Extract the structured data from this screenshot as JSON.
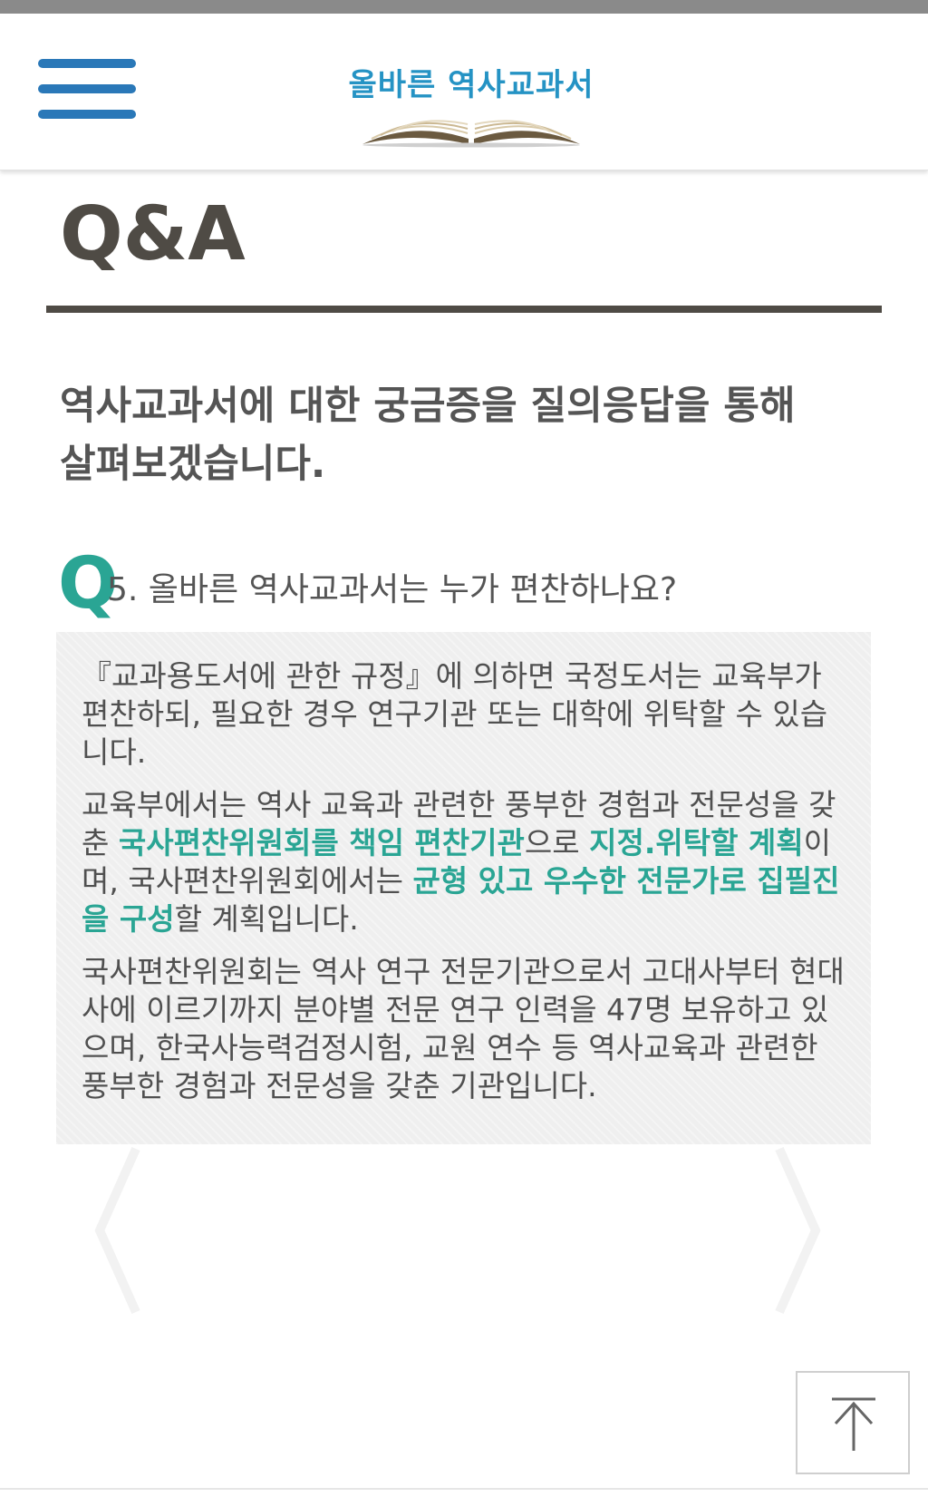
{
  "header": {
    "logo_text": "올바른 역사교과서",
    "icons": {
      "menu": "hamburger-menu-icon",
      "logo_image": "open-book-icon"
    },
    "accent_color": "#2a78b8"
  },
  "page": {
    "title": "Q&A",
    "intro_line1": "역사교과서에 대한 궁금증을 질의응답을 통해",
    "intro_line2": "살펴보겠습니다."
  },
  "question": {
    "mark": "Q",
    "text": "5. 올바른 역사교과서는 누가 편찬하나요?",
    "accent_color": "#2aa594"
  },
  "answer": {
    "p1": "『교과용도서에 관한 규정』에 의하면 국정도서는 교육부가 편찬하되, 필요한 경우 연구기관 또는 대학에 위탁할 수 있습니다.",
    "p2_segments": [
      "교육부에서는 역사 교육과 관련한 풍부한 경험과 전문성을 갖춘 ",
      "국사편찬위원회를 책임 편찬기관",
      "으로 ",
      "지정.위탁할 계획",
      "이며, 국사편찬위원회에서는 ",
      "균형 있고 우수한 전문가로 집필진을 구성",
      "할 계획입니다."
    ],
    "p3": "국사편찬위원회는 역사 연구 전문기관으로서 고대사부터 현대사에 이르기까지 분야별 전문 연구 인력을 47명 보유하고 있으며, 한국사능력검정시험, 교원 연수 등 역사교육과 관련한 풍부한 경험과 전문성을 갖춘 기관입니다."
  },
  "footer": {
    "scroll_top_icon": "arrow-up-to-top-icon"
  }
}
